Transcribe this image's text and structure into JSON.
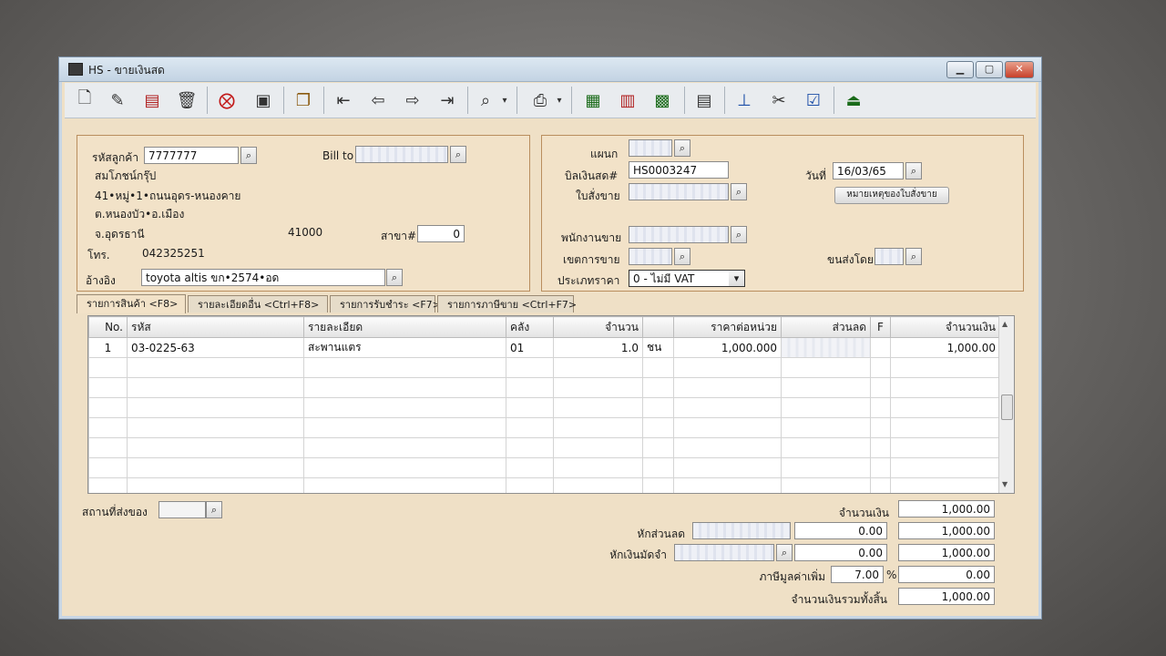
{
  "window": {
    "title": "HS - ขายเงินสด"
  },
  "toolbar": {
    "icons": [
      "new-icon",
      "edit-icon",
      "delete-doc-icon",
      "trash-icon",
      "cancel-icon",
      "save-icon",
      "copy-icon",
      "first-icon",
      "prev-icon",
      "next-icon",
      "last-icon",
      "search-icon",
      "print-icon",
      "preview-icon",
      "export-icon",
      "calc-icon",
      "report-icon",
      "approve-icon",
      "tool-icon",
      "ok-icon",
      "exit-icon"
    ]
  },
  "customer": {
    "code_label": "รหัสลูกค้า",
    "code": "7777777",
    "billto_label": "Bill to",
    "name": "สมโภชน์กรุ๊ป",
    "addr1": "41•หมู่•1•ถนนอุดร-หนองคาย",
    "addr2": "ต.หนองบัว•อ.เมือง",
    "addr3": "จ.อุดรธานี",
    "zip": "41000",
    "branch_label": "สาขา#",
    "branch": "0",
    "tel_label": "โทร.",
    "tel": "042325251",
    "ref_label": "อ้างอิง",
    "ref": "toyota altis ขก•2574•อด"
  },
  "doc": {
    "dept_label": "แผนก",
    "bill_label": "บิลเงินสด#",
    "bill_no": "HS0003247",
    "order_label": "ใบสั่งขาย",
    "date_label": "วันที่",
    "date": "16/03/65",
    "note_button": "หมายเหตุของใบสั่งขาย",
    "sales_label": "พนักงานขาย",
    "area_label": "เขตการขาย",
    "ship_label": "ขนส่งโดย",
    "price_type_label": "ประเภทราคา",
    "price_type": "0 - ไม่มี VAT"
  },
  "tabs": [
    "รายการสินค้า <F8>",
    "รายละเอียดอื่น <Ctrl+F8>",
    "รายการรับชำระ <F7>",
    "รายการภาษีขาย <Ctrl+F7>"
  ],
  "grid": {
    "headers": [
      "No.",
      "รหัส",
      "รายละเอียด",
      "คลัง",
      "จำนวน",
      "",
      "ราคาต่อหน่วย",
      "ส่วนลด",
      "F",
      "จำนวนเงิน"
    ],
    "rows": [
      [
        "1",
        "03-0225-63",
        "สะพานแตร",
        "01",
        "1.0",
        "ชน",
        "1,000.000",
        "",
        "",
        "1,000.00"
      ]
    ]
  },
  "footer": {
    "location_label": "สถานที่ส่งของ",
    "amount_label": "จำนวนเงิน",
    "amount": "1,000.00",
    "discount_label": "หักส่วนลด",
    "discount_value": "0.00",
    "after_discount": "1,000.00",
    "deposit_label": "หักเงินมัดจำ",
    "deposit_value": "0.00",
    "after_deposit": "1,000.00",
    "vat_label": "ภาษีมูลค่าเพิ่ม",
    "vat_rate": "7.00",
    "vat_pct": "%",
    "vat_amount": "0.00",
    "total_label": "จำนวนเงินรวมทั้งสิ้น",
    "total": "1,000.00"
  }
}
